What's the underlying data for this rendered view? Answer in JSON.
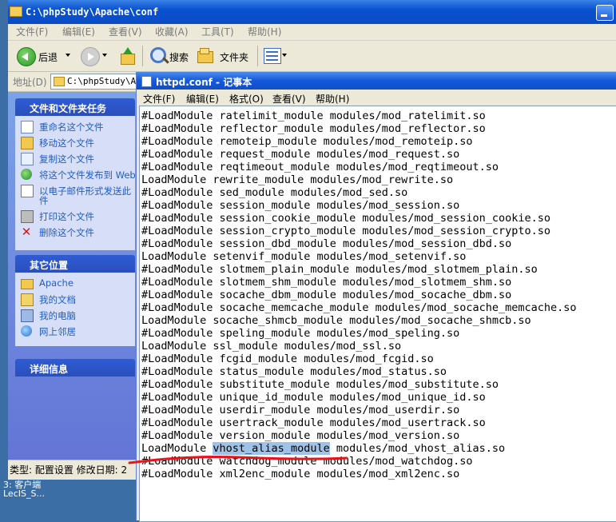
{
  "explorer": {
    "title": "C:\\phpStudy\\Apache\\conf",
    "menu": [
      "文件(F)",
      "编辑(E)",
      "查看(V)",
      "收藏(A)",
      "工具(T)",
      "帮助(H)"
    ],
    "toolbar": {
      "back": "后退",
      "search": "搜索",
      "folders": "文件夹"
    },
    "address": {
      "label": "地址(D)",
      "value": "C:\\phpStudy\\Apa"
    },
    "file_tasks": {
      "title": "文件和文件夹任务",
      "items": [
        "重命名这个文件",
        "移动这个文件",
        "复制这个文件",
        "将这个文件发布到 Web",
        "以电子邮件形式发送此",
        "件",
        "打印这个文件",
        "删除这个文件"
      ]
    },
    "other_places": {
      "title": "其它位置",
      "items": [
        "Apache",
        "我的文档",
        "我的电脑",
        "网上邻居"
      ]
    },
    "details": {
      "title": "详细信息"
    },
    "status": "类型: 配置设置 修改日期: 2"
  },
  "desktop": {
    "label1": "3: 客户端",
    "label2": "LecIS_S..."
  },
  "notepad": {
    "title": "httpd.conf - 记事本",
    "menu": [
      "文件(F)",
      "编辑(E)",
      "格式(O)",
      "查看(V)",
      "帮助(H)"
    ],
    "lines": [
      "#LoadModule ratelimit_module modules/mod_ratelimit.so",
      "#LoadModule reflector_module modules/mod_reflector.so",
      "#LoadModule remoteip_module modules/mod_remoteip.so",
      "#LoadModule request_module modules/mod_request.so",
      "#LoadModule reqtimeout_module modules/mod_reqtimeout.so",
      "LoadModule rewrite_module modules/mod_rewrite.so",
      "#LoadModule sed_module modules/mod_sed.so",
      "#LoadModule session_module modules/mod_session.so",
      "#LoadModule session_cookie_module modules/mod_session_cookie.so",
      "#LoadModule session_crypto_module modules/mod_session_crypto.so",
      "#LoadModule session_dbd_module modules/mod_session_dbd.so",
      "LoadModule setenvif_module modules/mod_setenvif.so",
      "#LoadModule slotmem_plain_module modules/mod_slotmem_plain.so",
      "#LoadModule slotmem_shm_module modules/mod_slotmem_shm.so",
      "#LoadModule socache_dbm_module modules/mod_socache_dbm.so",
      "#LoadModule socache_memcache_module modules/mod_socache_memcache.so",
      "LoadModule socache_shmcb_module modules/mod_socache_shmcb.so",
      "#LoadModule speling_module modules/mod_speling.so",
      "LoadModule ssl_module modules/mod_ssl.so",
      "#LoadModule fcgid_module modules/mod_fcgid.so",
      "#LoadModule status_module modules/mod_status.so",
      "#LoadModule substitute_module modules/mod_substitute.so",
      "#LoadModule unique_id_module modules/mod_unique_id.so",
      "#LoadModule userdir_module modules/mod_userdir.so",
      "#LoadModule usertrack_module modules/mod_usertrack.so",
      "#LoadModule version_module modules/mod_version.so",
      "LoadModule vhost_alias_module modules/mod_vhost_alias.so",
      "#LoadModule watchdog_module modules/mod_watchdog.so",
      "#LoadModule xml2enc_module modules/mod_xml2enc.so"
    ],
    "selected_line": {
      "before": "LoadModule ",
      "selected": "vhost_alias_module",
      "after": " modules/mod_vhost_alias.so"
    }
  },
  "colors": {
    "title_bar": "#0a4cc4",
    "selection": "#9ec2e8",
    "annotation_stroke": "#e8141b",
    "task_link": "#215dc6"
  }
}
